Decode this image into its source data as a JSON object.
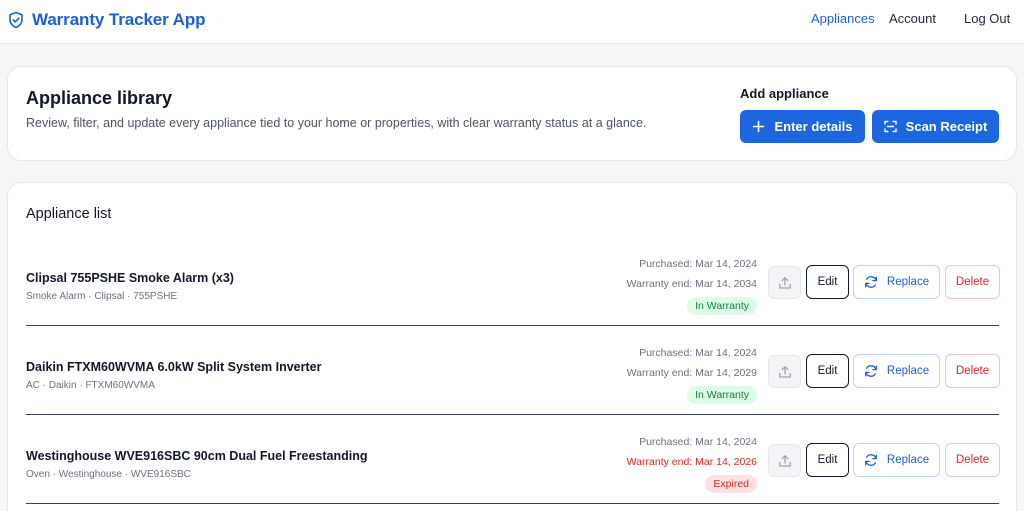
{
  "header": {
    "app_name": "Warranty Tracker App",
    "brand_color": "#1d5fd6",
    "nav": [
      {
        "label": "Appliances",
        "active": true
      },
      {
        "label": "Account",
        "active": false
      },
      {
        "label": "Log Out",
        "active": false
      }
    ]
  },
  "library": {
    "title": "Appliance library",
    "description": "Review, filter, and update every appliance tied to your home or properties, with clear warranty status at a glance.",
    "add_label": "Add appliance",
    "enter_details_label": "Enter details",
    "scan_receipt_label": "Scan Receipt",
    "accent_color": "#1d66e0"
  },
  "list": {
    "title": "Appliance list",
    "edit_label": "Edit",
    "replace_label": "Replace",
    "delete_label": "Delete",
    "rows": [
      {
        "name": "Clipsal 755PSHE Smoke Alarm (x3)",
        "subtitle": "Smoke Alarm · Clipsal · 755PSHE",
        "purchased": "Purchased: Mar 14, 2024",
        "warranty_end": "Warranty end: Mar 14, 2034",
        "status": "In Warranty",
        "expired": false
      },
      {
        "name": "Daikin FTXM60WVMA 6.0kW Split System Inverter",
        "subtitle": "AC · Daikin · FTXM60WVMA",
        "purchased": "Purchased: Mar 14, 2024",
        "warranty_end": "Warranty end: Mar 14, 2029",
        "status": "In Warranty",
        "expired": false
      },
      {
        "name": "Westinghouse WVE916SBC 90cm Dual Fuel Freestanding",
        "subtitle": "Oven · Westinghouse · WVE916SBC",
        "purchased": "Purchased: Mar 14, 2024",
        "warranty_end": "Warranty end: Mar 14, 2026",
        "status": "Expired",
        "expired": true
      }
    ]
  }
}
